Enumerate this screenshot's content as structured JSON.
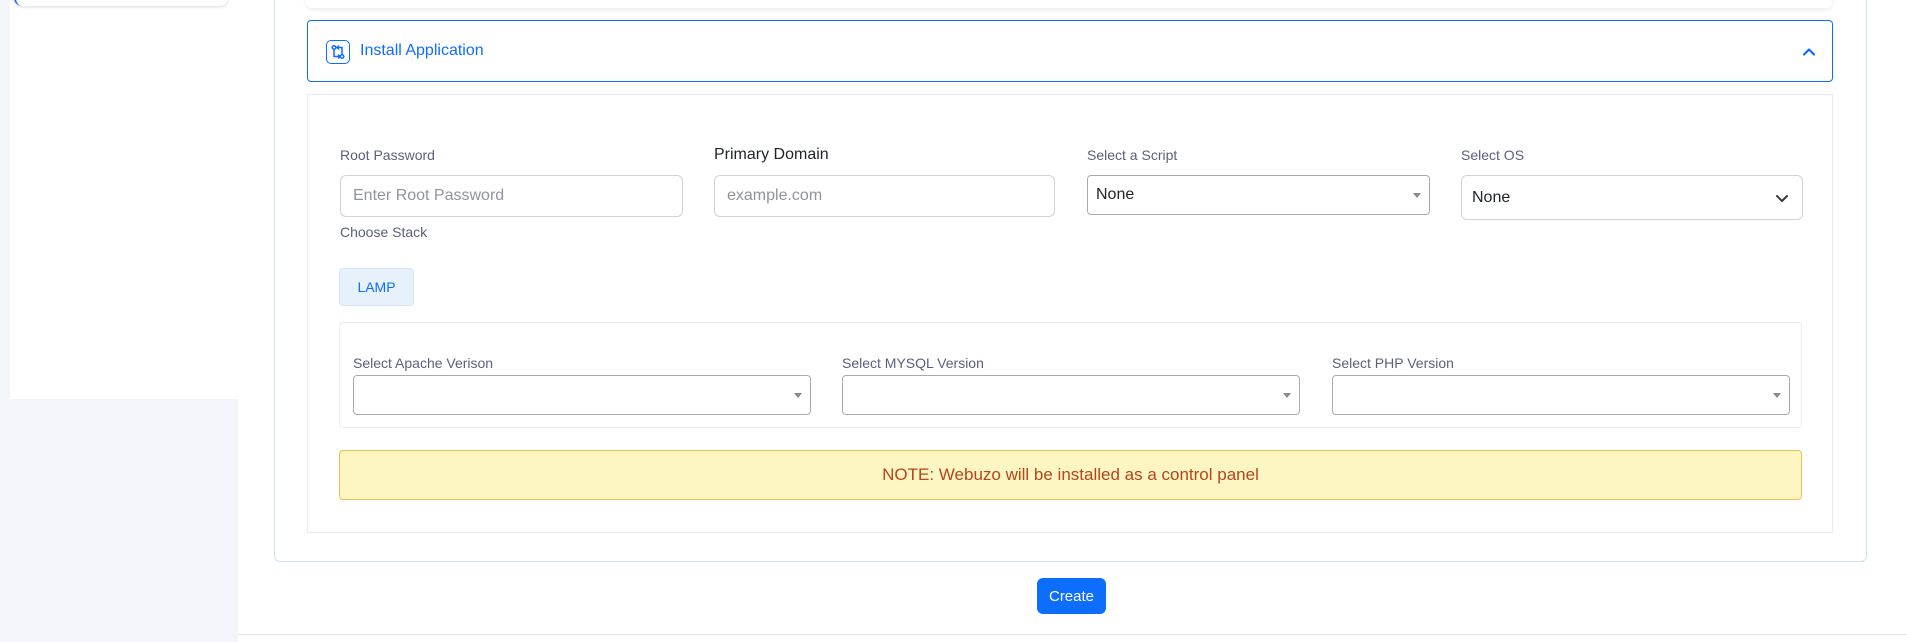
{
  "accordion": {
    "title": "Install Application",
    "icon": "git-compare-icon",
    "expanded": true
  },
  "form": {
    "root_password": {
      "label": "Root Password",
      "placeholder": "Enter Root Password",
      "value": ""
    },
    "primary_domain": {
      "label": "Primary Domain",
      "placeholder": "example.com",
      "value": ""
    },
    "script": {
      "label": "Select a Script",
      "selected": "None"
    },
    "os": {
      "label": "Select OS",
      "selected": "None"
    },
    "stack": {
      "label": "Choose Stack",
      "options": [
        "LAMP"
      ],
      "selected": "LAMP"
    },
    "versions": {
      "apache": {
        "label": "Select Apache Verison",
        "selected": ""
      },
      "mysql": {
        "label": "Select MYSQL Version",
        "selected": ""
      },
      "php": {
        "label": "Select PHP Version",
        "selected": ""
      }
    },
    "note": "NOTE: Webuzo will be installed as a control panel",
    "submit_label": "Create"
  },
  "colors": {
    "accent": "#0d6efd",
    "note_bg": "#fdf6c3",
    "note_text": "#b5451b",
    "note_border": "#e3c34d"
  }
}
